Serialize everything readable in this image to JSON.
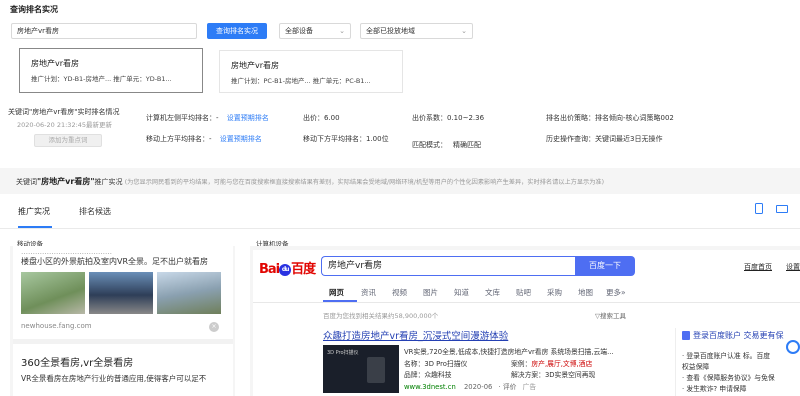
{
  "page_title": "查询排名实况",
  "search": {
    "value": "房地产vr看房",
    "button": "查询排名实况"
  },
  "device_select": "全部设备",
  "region_select": "全部已投放地域",
  "cards": [
    {
      "title": "房地产vr看房",
      "sub": "推广计划：YD-B1-房地产...   推广单元：YD-B1..."
    },
    {
      "title": "房地产vr看房",
      "sub": "推广计划：PC-B1-房地产...   推广单元：PC-B1..."
    }
  ],
  "keyword_info": {
    "label": "关键词\"房地产vr看房\"实时排名情况",
    "time": "2020-06-20 21:32:45最新更新",
    "add_btn": "添加为重点词"
  },
  "stats": {
    "row1": [
      {
        "label": "计算机左侧平均排名：",
        "value": "-",
        "link": "设置预期排名"
      },
      {
        "label": "出价：",
        "value": "6.00"
      },
      {
        "label": "出价系数：",
        "value": "0.10~2.36"
      },
      {
        "label": "排名出价策略：",
        "value": "排名倾向-核心词策略002"
      }
    ],
    "row2": [
      {
        "label": "移动上方平均排名：",
        "value": "-",
        "link": "设置预期排名"
      },
      {
        "label": "移动下方平均排名：",
        "value": "1.00位"
      },
      {
        "label": "匹配模式：",
        "value": "精确匹配"
      },
      {
        "label": "历史操作查询：",
        "value": "关键词最近3日无操作"
      }
    ]
  },
  "notice": {
    "prefix": "关键词",
    "keyword": "\"房地产vr看房\"",
    "suffix": "推广实况",
    "desc": "(为您显示网民看到的平均结果，可能与您在百度搜索框直接搜索结果有差别，实际结果会受地域/网络环境/机型等用户的个性化因素影响产生差异，实时排名请以上方显示为准)"
  },
  "tabs": [
    "推广实况",
    "排名候选"
  ],
  "mobile": {
    "section": "移动设备",
    "top_text": "楼盘小区的外景航拍及室内VR全景。足不出户就看房",
    "domain": "newhouse.fang.com",
    "headline": "360全景看房,vr全景看房",
    "para1": "VR全景看房在房地产行业的普通应用,使得客户可以足不"
  },
  "desktop": {
    "section": "计算机设备",
    "logo": "百度",
    "query": "房地产vr看房",
    "search_btn": "百度一下",
    "top_links": [
      "百度首页",
      "设置"
    ],
    "nav": [
      "网页",
      "资讯",
      "视频",
      "图片",
      "知道",
      "文库",
      "贴吧",
      "采购",
      "地图",
      "更多»"
    ],
    "result_count": "百度为您找到相关结果约58,900,000个",
    "tools": "搜索工具",
    "ad": {
      "title": "众趣打造房地产vr看房_沉浸式空间漫游体验",
      "line1": "VR实景,720全景,低成本,快捷打造房地产vr看房 系统场景扫描,云端...",
      "name_label": "名称：",
      "name": "3D Pro扫描仪",
      "case_label": "案例：",
      "case": "房产,展厅,文博,酒店",
      "brand_label": "品牌：",
      "brand": "众趣科技",
      "solution_label": "解决方案：",
      "solution": "3D实景空间再现",
      "url": "www.3dnest.cn",
      "date": "2020-06",
      "eval": "评价",
      "ad_tag": "广告",
      "thumb_label": "3D Pro扫描仪"
    },
    "side": {
      "title": "登录百度账户  交易更有保",
      "line1": "· 登录百度账户认准 标。百度",
      "line2": "权益保障",
      "line3": "· 查看《保障服务协议》与免保",
      "line4": "· 发生欺诈? 申请保障"
    }
  }
}
